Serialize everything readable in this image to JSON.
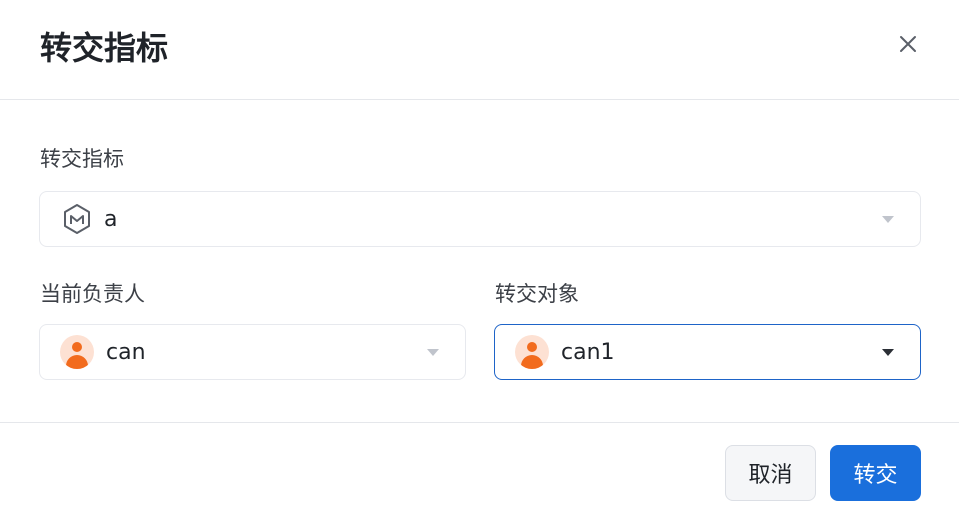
{
  "dialog": {
    "title": "转交指标",
    "close_icon": "close-icon"
  },
  "form": {
    "metric": {
      "label": "转交指标",
      "value": "a",
      "icon": "metric-hex-icon"
    },
    "current_owner": {
      "label": "当前负责人",
      "value": "can",
      "icon": "user-avatar-icon"
    },
    "transfer_target": {
      "label": "转交对象",
      "value": "can1",
      "icon": "user-avatar-icon"
    }
  },
  "footer": {
    "cancel_label": "取消",
    "confirm_label": "转交"
  },
  "colors": {
    "primary": "#1a6fdc",
    "avatar_bg": "#fde1d3",
    "avatar_fg": "#f26b1d",
    "active_border": "#1e64c8"
  }
}
